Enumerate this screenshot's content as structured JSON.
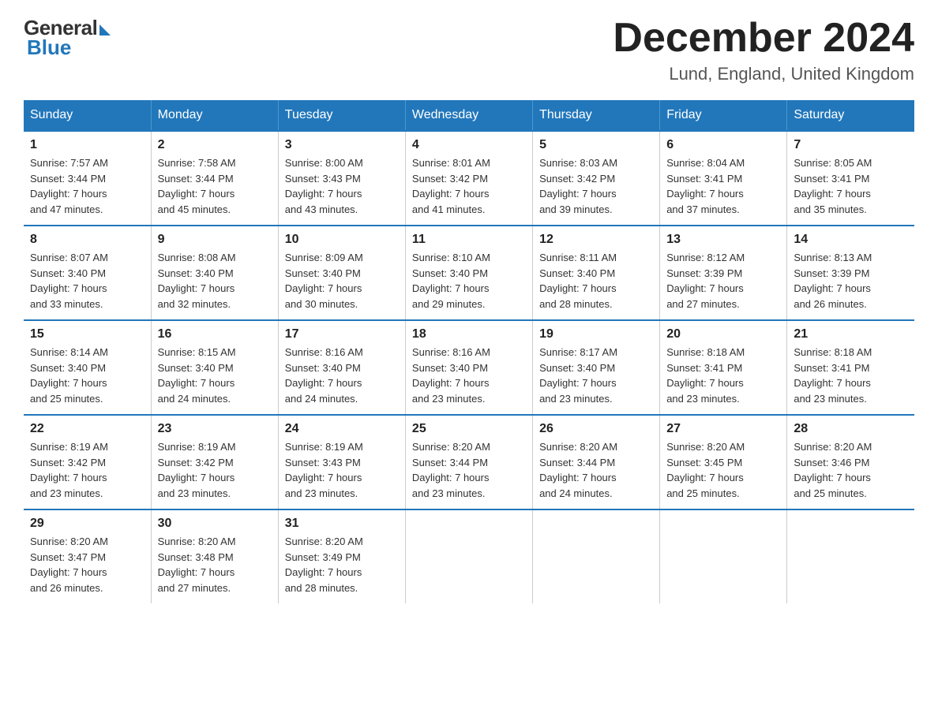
{
  "logo": {
    "general": "General",
    "blue": "Blue"
  },
  "title": "December 2024",
  "location": "Lund, England, United Kingdom",
  "days_of_week": [
    "Sunday",
    "Monday",
    "Tuesday",
    "Wednesday",
    "Thursday",
    "Friday",
    "Saturday"
  ],
  "weeks": [
    [
      {
        "day": "1",
        "sunrise": "7:57 AM",
        "sunset": "3:44 PM",
        "daylight": "7 hours and 47 minutes."
      },
      {
        "day": "2",
        "sunrise": "7:58 AM",
        "sunset": "3:44 PM",
        "daylight": "7 hours and 45 minutes."
      },
      {
        "day": "3",
        "sunrise": "8:00 AM",
        "sunset": "3:43 PM",
        "daylight": "7 hours and 43 minutes."
      },
      {
        "day": "4",
        "sunrise": "8:01 AM",
        "sunset": "3:42 PM",
        "daylight": "7 hours and 41 minutes."
      },
      {
        "day": "5",
        "sunrise": "8:03 AM",
        "sunset": "3:42 PM",
        "daylight": "7 hours and 39 minutes."
      },
      {
        "day": "6",
        "sunrise": "8:04 AM",
        "sunset": "3:41 PM",
        "daylight": "7 hours and 37 minutes."
      },
      {
        "day": "7",
        "sunrise": "8:05 AM",
        "sunset": "3:41 PM",
        "daylight": "7 hours and 35 minutes."
      }
    ],
    [
      {
        "day": "8",
        "sunrise": "8:07 AM",
        "sunset": "3:40 PM",
        "daylight": "7 hours and 33 minutes."
      },
      {
        "day": "9",
        "sunrise": "8:08 AM",
        "sunset": "3:40 PM",
        "daylight": "7 hours and 32 minutes."
      },
      {
        "day": "10",
        "sunrise": "8:09 AM",
        "sunset": "3:40 PM",
        "daylight": "7 hours and 30 minutes."
      },
      {
        "day": "11",
        "sunrise": "8:10 AM",
        "sunset": "3:40 PM",
        "daylight": "7 hours and 29 minutes."
      },
      {
        "day": "12",
        "sunrise": "8:11 AM",
        "sunset": "3:40 PM",
        "daylight": "7 hours and 28 minutes."
      },
      {
        "day": "13",
        "sunrise": "8:12 AM",
        "sunset": "3:39 PM",
        "daylight": "7 hours and 27 minutes."
      },
      {
        "day": "14",
        "sunrise": "8:13 AM",
        "sunset": "3:39 PM",
        "daylight": "7 hours and 26 minutes."
      }
    ],
    [
      {
        "day": "15",
        "sunrise": "8:14 AM",
        "sunset": "3:40 PM",
        "daylight": "7 hours and 25 minutes."
      },
      {
        "day": "16",
        "sunrise": "8:15 AM",
        "sunset": "3:40 PM",
        "daylight": "7 hours and 24 minutes."
      },
      {
        "day": "17",
        "sunrise": "8:16 AM",
        "sunset": "3:40 PM",
        "daylight": "7 hours and 24 minutes."
      },
      {
        "day": "18",
        "sunrise": "8:16 AM",
        "sunset": "3:40 PM",
        "daylight": "7 hours and 23 minutes."
      },
      {
        "day": "19",
        "sunrise": "8:17 AM",
        "sunset": "3:40 PM",
        "daylight": "7 hours and 23 minutes."
      },
      {
        "day": "20",
        "sunrise": "8:18 AM",
        "sunset": "3:41 PM",
        "daylight": "7 hours and 23 minutes."
      },
      {
        "day": "21",
        "sunrise": "8:18 AM",
        "sunset": "3:41 PM",
        "daylight": "7 hours and 23 minutes."
      }
    ],
    [
      {
        "day": "22",
        "sunrise": "8:19 AM",
        "sunset": "3:42 PM",
        "daylight": "7 hours and 23 minutes."
      },
      {
        "day": "23",
        "sunrise": "8:19 AM",
        "sunset": "3:42 PM",
        "daylight": "7 hours and 23 minutes."
      },
      {
        "day": "24",
        "sunrise": "8:19 AM",
        "sunset": "3:43 PM",
        "daylight": "7 hours and 23 minutes."
      },
      {
        "day": "25",
        "sunrise": "8:20 AM",
        "sunset": "3:44 PM",
        "daylight": "7 hours and 23 minutes."
      },
      {
        "day": "26",
        "sunrise": "8:20 AM",
        "sunset": "3:44 PM",
        "daylight": "7 hours and 24 minutes."
      },
      {
        "day": "27",
        "sunrise": "8:20 AM",
        "sunset": "3:45 PM",
        "daylight": "7 hours and 25 minutes."
      },
      {
        "day": "28",
        "sunrise": "8:20 AM",
        "sunset": "3:46 PM",
        "daylight": "7 hours and 25 minutes."
      }
    ],
    [
      {
        "day": "29",
        "sunrise": "8:20 AM",
        "sunset": "3:47 PM",
        "daylight": "7 hours and 26 minutes."
      },
      {
        "day": "30",
        "sunrise": "8:20 AM",
        "sunset": "3:48 PM",
        "daylight": "7 hours and 27 minutes."
      },
      {
        "day": "31",
        "sunrise": "8:20 AM",
        "sunset": "3:49 PM",
        "daylight": "7 hours and 28 minutes."
      },
      null,
      null,
      null,
      null
    ]
  ]
}
